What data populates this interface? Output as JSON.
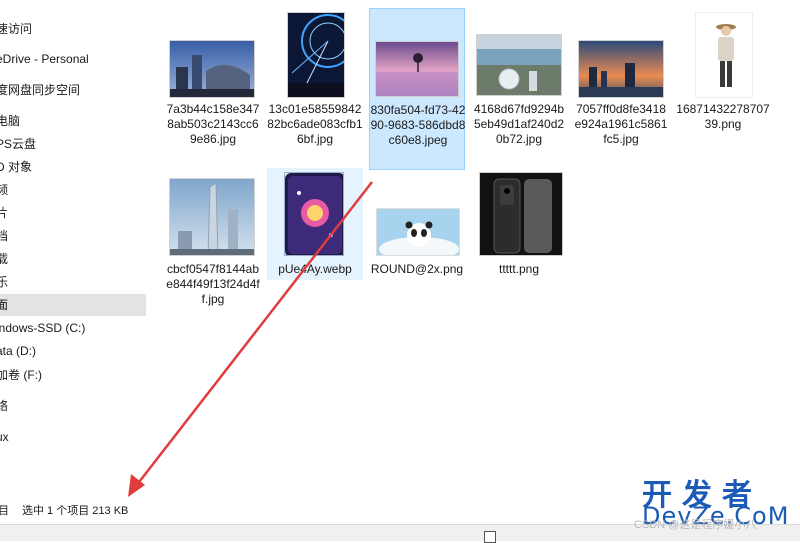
{
  "sidebar": {
    "items": [
      {
        "label": "速访问",
        "selected": false
      },
      {
        "label": "eDrive - Personal",
        "selected": false
      },
      {
        "label": "度网盘同步空间",
        "selected": false
      },
      {
        "label": "电脑",
        "selected": false
      },
      {
        "label": "PS云盘",
        "selected": false
      },
      {
        "label": "D 对象",
        "selected": false
      },
      {
        "label": "频",
        "selected": false
      },
      {
        "label": "片",
        "selected": false
      },
      {
        "label": "档",
        "selected": false
      },
      {
        "label": "载",
        "selected": false
      },
      {
        "label": "乐",
        "selected": false
      },
      {
        "label": "面",
        "selected": true
      },
      {
        "label": "indows-SSD (C:)",
        "selected": false
      },
      {
        "label": "ata (D:)",
        "selected": false
      },
      {
        "label": "加卷 (F:)",
        "selected": false
      },
      {
        "label": "络",
        "selected": false
      },
      {
        "label": "ux",
        "selected": false
      }
    ]
  },
  "files": [
    {
      "name": "7a3b44c158e3478ab503c2143cc69e86.jpg",
      "thumb": "city-night-icon"
    },
    {
      "name": "13c01e5855984282bc6ade083cfb16bf.jpg",
      "thumb": "ferris-wheel-icon"
    },
    {
      "name": "830fa504-fd73-4290-9683-586dbd8c60e8.jpeg",
      "thumb": "lake-tree-icon"
    },
    {
      "name": "4168d67fd9294b5eb49d1af240d20b72.jpg",
      "thumb": "aerial-city-icon"
    },
    {
      "name": "7057ff0d8fe3418e924a1961c5861fc5.jpg",
      "thumb": "skyline-dusk-icon"
    },
    {
      "name": "1687143227870739.png",
      "thumb": "person-icon"
    },
    {
      "name": "cbcf0547f8144abe844f49f13f24d4ff.jpg",
      "thumb": "skyscraper-icon"
    },
    {
      "name": "pUe4Ay.webp",
      "thumb": "phone-galaxy-icon"
    },
    {
      "name": "ROUND@2x.png",
      "thumb": "panda-cloud-icon"
    },
    {
      "name": "ttttt.png",
      "thumb": "phone-dark-icon"
    }
  ],
  "status": {
    "item_count_fragment": "目",
    "selection_text": "选中 1 个项目  213 KB"
  },
  "watermark": {
    "top": "开发者",
    "bottom": "DevZe.CoM",
    "csdn": "CSDN @这是程序媛小八"
  },
  "colors": {
    "selection_bg": "#cce8ff",
    "selection_border": "#99d1ff",
    "arrow": "#e03c3c",
    "watermark": "#1b5bb5"
  }
}
